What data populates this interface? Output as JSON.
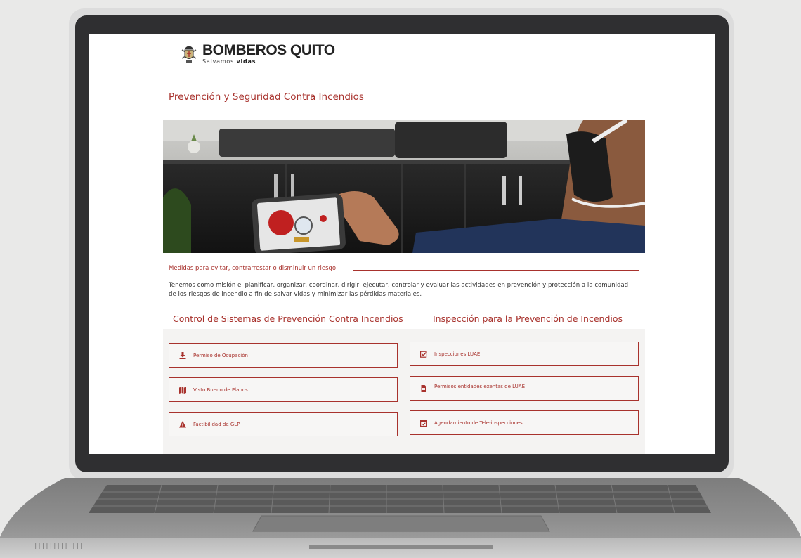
{
  "brand": {
    "name": "BOMBEROS QUITO",
    "tagline_light": "Salvamos",
    "tagline_bold": "vidas"
  },
  "page": {
    "title": "Prevención y Seguridad Contra Incendios",
    "subtitle": "Medidas para evitar, contrarrestar o disminuir un riesgo",
    "paragraph": "Tenemos como misión el planificar, organizar, coordinar, dirigir, ejecutar, controlar y evaluar las actividades en prevención y protección a la comunidad de los riesgos de incendio a fin de salvar vidas y minimizar las pérdidas materiales."
  },
  "sections": {
    "left": {
      "heading": "Control de Sistemas de Prevención Contra Incendios",
      "buttons": [
        {
          "label": "Permiso de Ocupación",
          "icon": "download-icon"
        },
        {
          "label": "Visto Bueno de Planos",
          "icon": "map-icon"
        },
        {
          "label": "Factibilidad de GLP",
          "icon": "warning-icon"
        }
      ]
    },
    "right": {
      "heading": "Inspección para la Prevención de Incendios",
      "buttons": [
        {
          "label": "Inspecciones LUAE",
          "icon": "checkbox-icon"
        },
        {
          "label": "Permisos entidades exentas de LUAE",
          "icon": "document-icon"
        },
        {
          "label": "Agendamiento de Tele-inspecciones",
          "icon": "calendar-check-icon"
        }
      ]
    }
  },
  "laptop": {
    "vent_marks": "|||||||||||||"
  },
  "colors": {
    "accent": "#a8322d",
    "panel": "#f4f3f2",
    "bezel": "#2f2f31"
  }
}
